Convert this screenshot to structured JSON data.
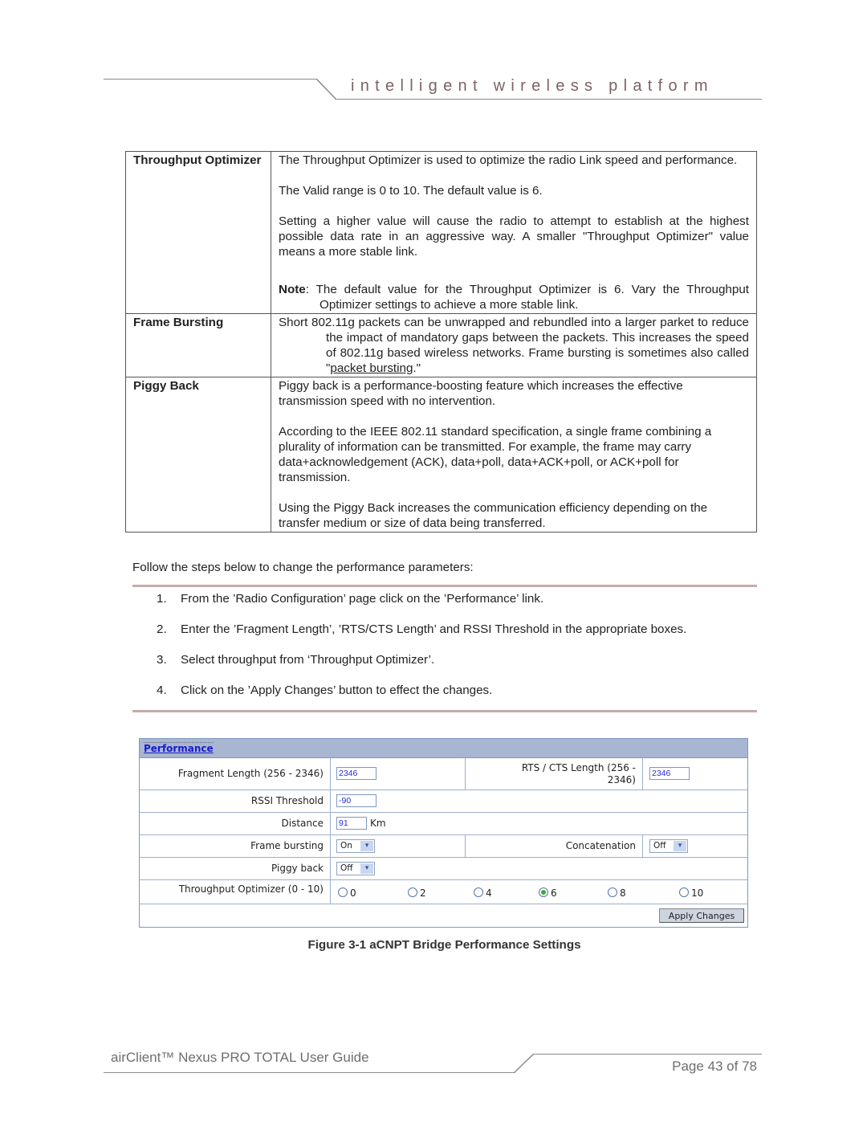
{
  "header": {
    "title": "intelligent wireless platform"
  },
  "definitions": [
    {
      "term": "Throughput Optimizer",
      "paragraphs": [
        "The Throughput Optimizer is used to optimize the radio Link speed and performance.",
        "The Valid range is 0 to 10. The default value is 6.",
        "Setting a higher value will cause the radio to attempt to establish at the highest possible data rate in an aggressive way. A smaller \"Throughput Optimizer\" value means a more stable link."
      ],
      "note_label": "Note",
      "note_text": ":  The default value for the Throughput Optimizer is 6. Vary the Throughput Optimizer settings to achieve a more stable link."
    },
    {
      "term": "Frame Bursting",
      "text_before": "Short 802.11g packets can be unwrapped and rebundled into a larger parket to reduce the impact of mandatory gaps between the packets. This increases the speed of 802.11g based wireless networks. Frame bursting is sometimes also called \"",
      "link_text": "packet bursting",
      "text_after": ".\""
    },
    {
      "term": "Piggy Back",
      "paragraphs": [
        "Piggy back is a performance-boosting feature which increases the effective transmission speed with no intervention.",
        "According to the IEEE 802.11 standard specification, a single frame combining a plurality of information can be transmitted. For example, the frame may carry data+acknowledgement (ACK), data+poll, data+ACK+poll, or ACK+poll for transmission.",
        "Using the Piggy Back increases the communication efficiency depending on the transfer medium or size of data being transferred."
      ]
    }
  ],
  "intro": "Follow the steps below to change the performance parameters:",
  "steps": [
    {
      "num": "1.",
      "text": "From the ’Radio Configuration’ page click on the ’Performance’ link."
    },
    {
      "num": "2.",
      "text": "Enter the ’Fragment Length’, ’RTS/CTS Length’ and RSSI Threshold in the appropriate boxes."
    },
    {
      "num": "3.",
      "text": "Select throughput from ‘Throughput Optimizer’."
    },
    {
      "num": "4.",
      "text": "Click on the ’Apply Changes’ button to effect the changes."
    }
  ],
  "panel": {
    "title": "Performance",
    "fragment_label": "Fragment Length (256 - 2346)",
    "fragment_value": "2346",
    "rts_label_line1": "RTS / CTS Length (256 -",
    "rts_label_line2": "2346)",
    "rts_value": "2346",
    "rssi_label": "RSSI Threshold",
    "rssi_value": "-90",
    "distance_label": "Distance",
    "distance_value": "91",
    "distance_unit": "Km",
    "frame_bursting_label": "Frame bursting",
    "frame_bursting_value": "On",
    "concatenation_label": "Concatenation",
    "concatenation_value": "Off",
    "piggy_back_label": "Piggy back",
    "piggy_back_value": "Off",
    "throughput_label": "Throughput Optimizer (0 - 10)",
    "throughput_options": [
      "0",
      "2",
      "4",
      "6",
      "8",
      "10"
    ],
    "throughput_selected": "6",
    "apply_label": "Apply Changes",
    "dropdown_arrow": "▾",
    "colors": {
      "header_bg": "#a8b6d2",
      "border": "#7d98c0",
      "link": "#1a1acc",
      "input_text": "#2a2adb",
      "radio_selected": "#2fb22f"
    }
  },
  "caption": "Figure 3-1 aCNPT Bridge Performance Settings",
  "footer": {
    "guide_title": "airClient™ Nexus PRO TOTAL User Guide",
    "page": "Page 43 of 78"
  }
}
